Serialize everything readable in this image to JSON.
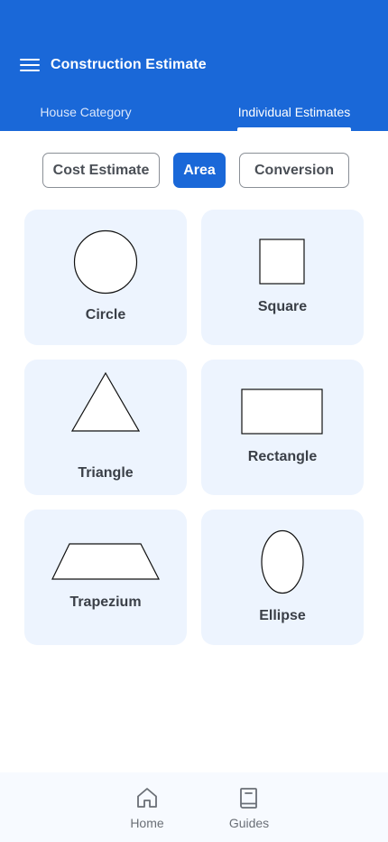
{
  "header": {
    "title": "Construction Estimate",
    "tabs": [
      {
        "label": "House Category"
      },
      {
        "label": "Individual Estimates",
        "active": true
      }
    ],
    "background_color": "#1a68d8"
  },
  "segments": [
    {
      "label": "Cost Estimate"
    },
    {
      "label": "Area",
      "active": true
    },
    {
      "label": "Conversion"
    }
  ],
  "shapes": [
    {
      "label": "Circle",
      "icon": "circle-icon"
    },
    {
      "label": "Square",
      "icon": "square-icon"
    },
    {
      "label": "Triangle",
      "icon": "triangle-icon"
    },
    {
      "label": "Rectangle",
      "icon": "rectangle-icon"
    },
    {
      "label": "Trapezium",
      "icon": "trapezium-icon"
    },
    {
      "label": "Ellipse",
      "icon": "ellipse-icon"
    }
  ],
  "bottom_nav": [
    {
      "label": "Home",
      "icon": "home-icon"
    },
    {
      "label": "Guides",
      "icon": "book-icon"
    }
  ]
}
